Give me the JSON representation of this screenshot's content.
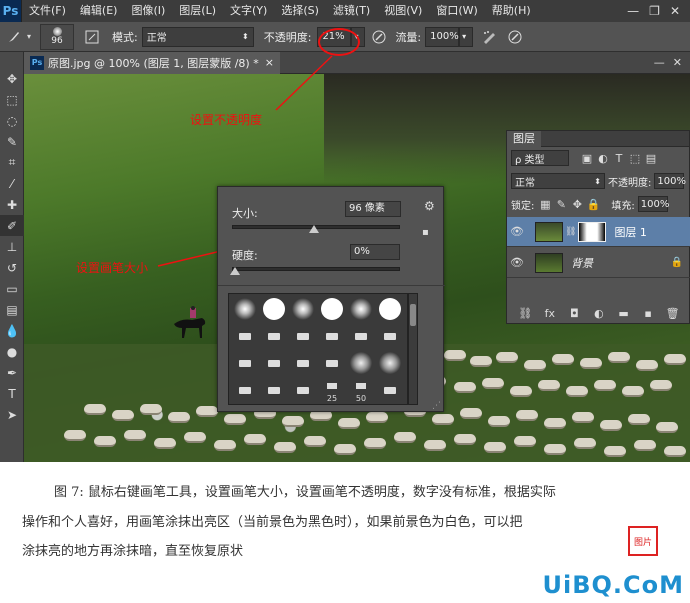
{
  "menubar": {
    "logo": "Ps",
    "items": [
      "文件(F)",
      "编辑(E)",
      "图像(I)",
      "图层(L)",
      "文字(Y)",
      "选择(S)",
      "滤镜(T)",
      "视图(V)",
      "窗口(W)",
      "帮助(H)"
    ],
    "minimize": "—",
    "restore": "❐",
    "close": "✕"
  },
  "options": {
    "brush_size": "96",
    "mode_label": "模式:",
    "mode_value": "正常",
    "opacity_label": "不透明度:",
    "opacity_value": "21%",
    "flow_label": "流量:",
    "flow_value": "100%"
  },
  "document": {
    "tab_title": "原图.jpg @ 100% (图层 1, 图层蒙版 /8) *",
    "tab_close": "×",
    "logo": "Ps"
  },
  "annotations": {
    "opacity": "设置不透明度",
    "brush_size": "设置画笔大小"
  },
  "brush_popup": {
    "size_label": "大小:",
    "size_value": "96 像素",
    "hardness_label": "硬度:",
    "hardness_value": "0%",
    "size_fraction": 0.49,
    "hardness_fraction": 0.0,
    "preset_sizes": [
      "25",
      "50"
    ]
  },
  "layers": {
    "tab": "图层",
    "filter_value": "ρ 类型",
    "blend_mode": "正常",
    "opacity_label": "不透明度:",
    "opacity_value": "100%",
    "lock_label": "锁定:",
    "fill_label": "填充:",
    "fill_value": "100%",
    "items": [
      {
        "name": "图层 1",
        "selected": true
      },
      {
        "name": "背景",
        "selected": false
      }
    ]
  },
  "caption": {
    "line1": "图 7: 鼠标右键画笔工具，设置画笔大小，设置画笔不透明度，数字没有标准，根据实际",
    "line2": "操作和个人喜好，用画笔涂抹出亮区（当前景色为黑色时），如果前景色为白色，可以把",
    "line3": "涂抹亮的地方再涂抹暗，直至恢复原状",
    "stamp": "图片",
    "watermark": "UiBQ.CoM"
  },
  "colors": {
    "annotation": "#e11111",
    "watermark": "#1e8fcf",
    "selected_layer": "#5d7fa8"
  }
}
